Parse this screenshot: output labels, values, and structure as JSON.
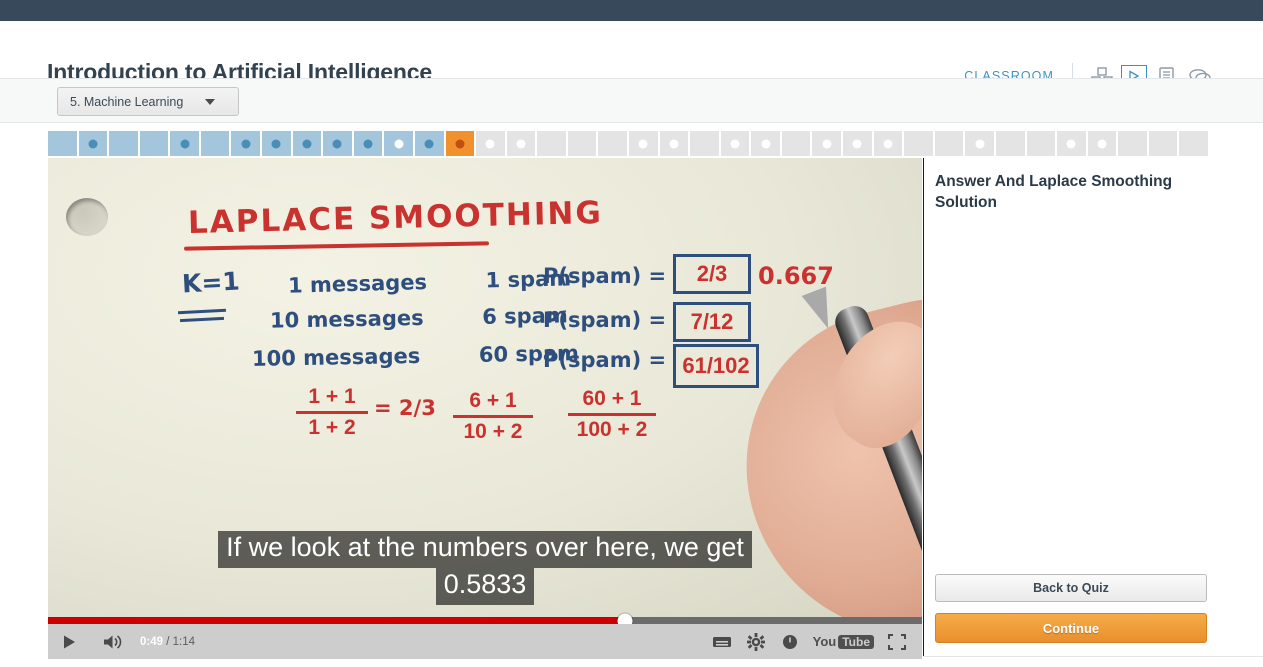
{
  "topbar": {
    "color": "#37495a"
  },
  "header": {
    "course_title": "Introduction to Artificial Intelligence",
    "classroom_label": "CLASSROOM",
    "icons": [
      {
        "name": "course-map-icon",
        "glyph": "blocks"
      },
      {
        "name": "video-play-icon",
        "glyph": "play-box"
      },
      {
        "name": "notes-icon",
        "glyph": "document"
      },
      {
        "name": "discussion-icon",
        "glyph": "chat-bubbles"
      }
    ],
    "accent_color": "#3a93c4"
  },
  "unit": {
    "selected": "5. Machine Learning",
    "caret": "chevron-down-icon"
  },
  "progress": {
    "done_color": "#a3c6dc",
    "todo_color": "#e4e4e4",
    "current_color": "#f0912d",
    "segments": [
      {
        "state": "done",
        "dot": "none"
      },
      {
        "state": "done",
        "dot": "blue"
      },
      {
        "state": "done",
        "dot": "none"
      },
      {
        "state": "done",
        "dot": "none"
      },
      {
        "state": "done",
        "dot": "blue"
      },
      {
        "state": "done",
        "dot": "none"
      },
      {
        "state": "done",
        "dot": "blue"
      },
      {
        "state": "done",
        "dot": "blue"
      },
      {
        "state": "done",
        "dot": "blue"
      },
      {
        "state": "done",
        "dot": "blue"
      },
      {
        "state": "done",
        "dot": "blue"
      },
      {
        "state": "done",
        "dot": "white"
      },
      {
        "state": "done",
        "dot": "blue"
      },
      {
        "state": "current",
        "dot": "dark"
      },
      {
        "state": "todo",
        "dot": "white"
      },
      {
        "state": "todo",
        "dot": "white"
      },
      {
        "state": "todo",
        "dot": "none"
      },
      {
        "state": "todo",
        "dot": "none"
      },
      {
        "state": "todo",
        "dot": "none"
      },
      {
        "state": "todo",
        "dot": "white"
      },
      {
        "state": "todo",
        "dot": "white"
      },
      {
        "state": "todo",
        "dot": "none"
      },
      {
        "state": "todo",
        "dot": "white"
      },
      {
        "state": "todo",
        "dot": "white"
      },
      {
        "state": "todo",
        "dot": "none"
      },
      {
        "state": "todo",
        "dot": "white"
      },
      {
        "state": "todo",
        "dot": "white"
      },
      {
        "state": "todo",
        "dot": "white"
      },
      {
        "state": "todo",
        "dot": "none"
      },
      {
        "state": "todo",
        "dot": "none"
      },
      {
        "state": "todo",
        "dot": "white"
      },
      {
        "state": "todo",
        "dot": "none"
      },
      {
        "state": "todo",
        "dot": "none"
      },
      {
        "state": "todo",
        "dot": "white"
      },
      {
        "state": "todo",
        "dot": "white"
      },
      {
        "state": "todo",
        "dot": "none"
      },
      {
        "state": "todo",
        "dot": "none"
      },
      {
        "state": "todo",
        "dot": "none"
      }
    ]
  },
  "video": {
    "whiteboard": {
      "title": "LAPLACE SMOOTHING",
      "k_value": "K=1",
      "rows": [
        {
          "count": "1 messages",
          "spam": "1 spam"
        },
        {
          "count": "10 messages",
          "spam": "6 spam"
        },
        {
          "count": "100 messages",
          "spam": "60 spam"
        }
      ],
      "equations": [
        {
          "label": "P(spam) =",
          "boxed": "2/3",
          "annotation": "0.667"
        },
        {
          "label": "P(spam) =",
          "boxed": "7/12",
          "annotation": ""
        },
        {
          "label": "P(spam) =",
          "boxed": "61/102",
          "annotation": ""
        }
      ],
      "fractions": [
        {
          "num": "1 + 1",
          "den": "1 + 2",
          "equals": "2/3"
        },
        {
          "num": "6 + 1",
          "den": "10 + 2",
          "equals": ""
        },
        {
          "num": "60 + 1",
          "den": "100 + 2",
          "equals": ""
        }
      ],
      "equals_symbol": "="
    },
    "subtitles": [
      "If we look at the numbers over here, we get",
      "0.5833"
    ],
    "controls": {
      "play_icon": "play-icon",
      "volume_icon": "volume-icon",
      "current_time": "0:49",
      "time_separator": " / ",
      "total_time": "1:14",
      "captions_icon": "captions-icon",
      "settings_icon": "gear-icon",
      "info_icon": "info-icon",
      "brand_you": "You",
      "brand_tube": "Tube",
      "fullscreen_icon": "fullscreen-icon",
      "progress_percent": 66,
      "progress_color": "#cc0000"
    }
  },
  "sidebar": {
    "title": "Answer And Laplace Smoothing Solution",
    "back_label": "Back to Quiz",
    "continue_label": "Continue",
    "continue_color": "#ef9a33"
  }
}
